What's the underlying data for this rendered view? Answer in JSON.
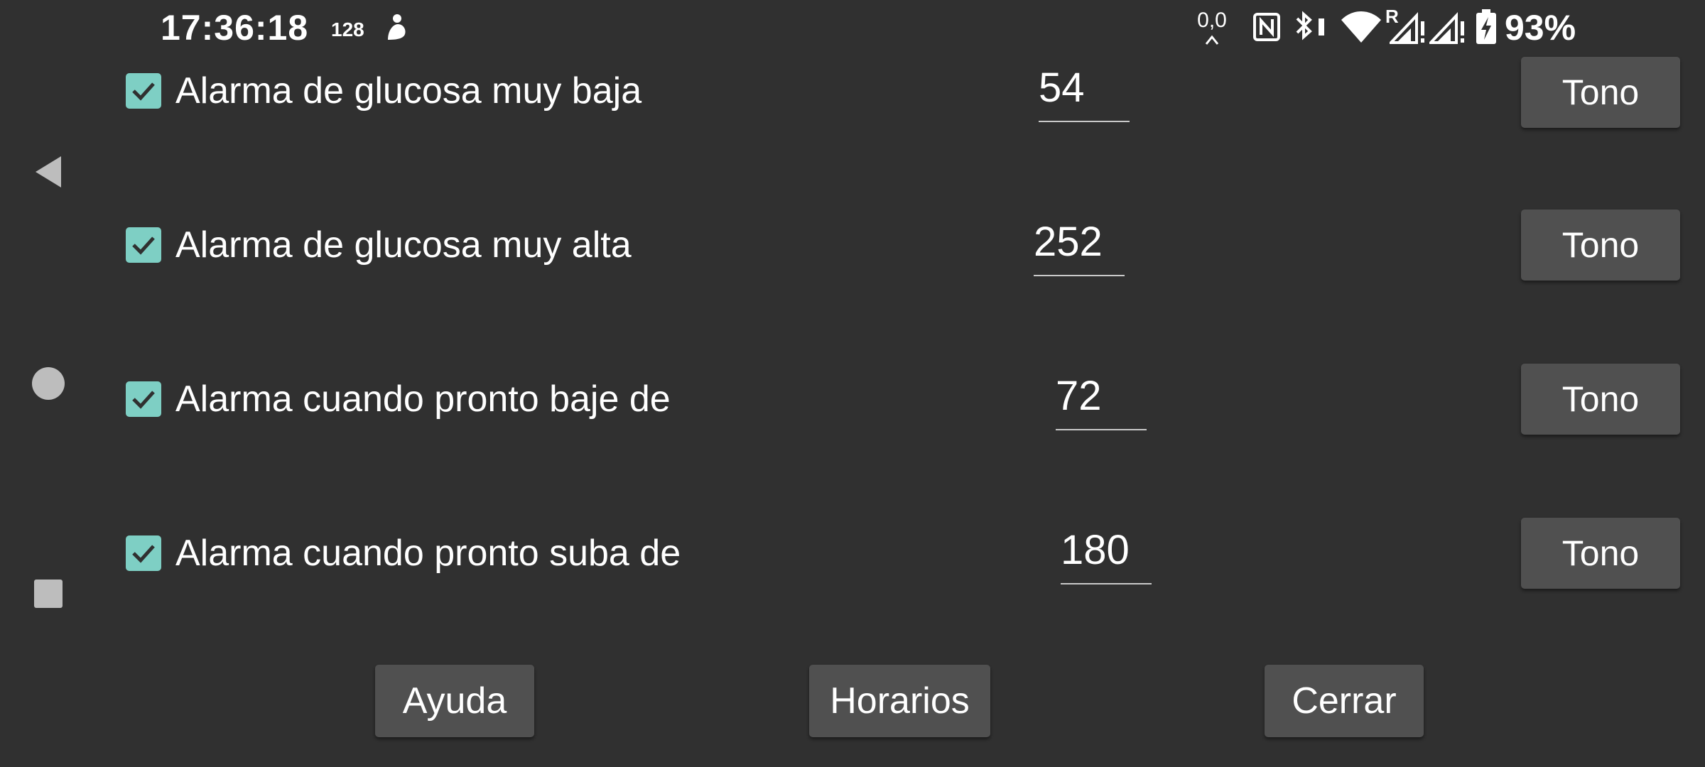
{
  "status_bar": {
    "time": "17:36:18",
    "notification_count": "128",
    "speed": "0,0",
    "battery_percent": "93%",
    "icons": [
      "person-icon",
      "nfc-icon",
      "bluetooth-icon",
      "wifi-icon",
      "signal-icon",
      "signal-icon",
      "battery-charging-icon"
    ],
    "roaming_label": "R"
  },
  "navigation": {
    "icons": [
      "back-icon",
      "home-icon",
      "recents-icon"
    ]
  },
  "alarms": [
    {
      "checked": true,
      "label": "Alarma de glucosa muy baja",
      "value": "54",
      "tone_label": "Tono"
    },
    {
      "checked": true,
      "label": "Alarma de glucosa muy alta",
      "value": "252",
      "tone_label": "Tono"
    },
    {
      "checked": true,
      "label": "Alarma cuando pronto baje de",
      "value": "72",
      "tone_label": "Tono"
    },
    {
      "checked": true,
      "label": "Alarma cuando pronto suba de",
      "value": "180",
      "tone_label": "Tono"
    }
  ],
  "buttons": {
    "help": "Ayuda",
    "schedules": "Horarios",
    "close": "Cerrar"
  },
  "colors": {
    "background": "#303030",
    "accent": "#7ecfc4",
    "button": "#505050"
  }
}
